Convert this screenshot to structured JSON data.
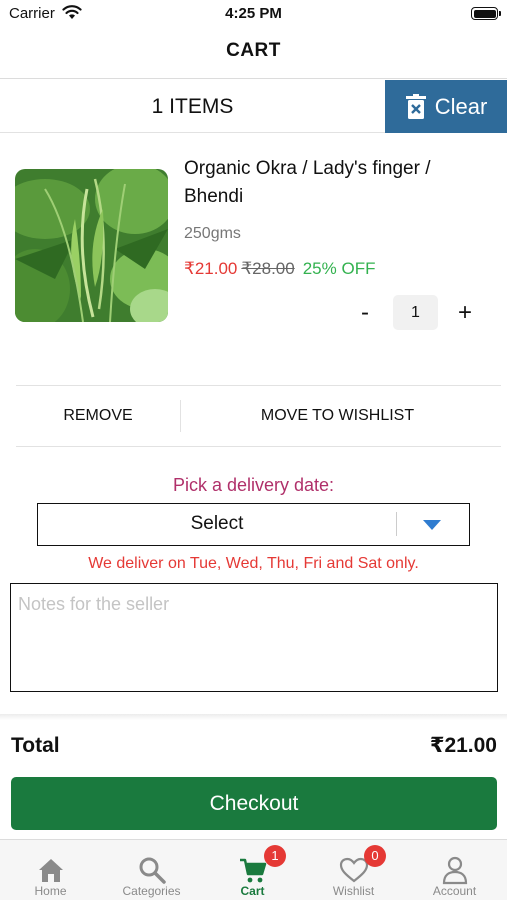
{
  "status_bar": {
    "carrier": "Carrier",
    "time": "4:25 PM"
  },
  "nav": {
    "title": "CART"
  },
  "cart_header": {
    "items_label": "1 ITEMS",
    "clear_label": "Clear",
    "clear_color": "#2f6b9a"
  },
  "product": {
    "name": "Organic Okra / Lady's finger /  Bhendi",
    "weight": "250gms",
    "price": "₹21.00",
    "original_price": "₹28.00",
    "discount": "25% OFF",
    "quantity": "1",
    "minus_label": "-",
    "plus_label": "+"
  },
  "actions": {
    "remove_label": "REMOVE",
    "wishlist_label": "MOVE TO WISHLIST"
  },
  "delivery": {
    "label": "Pick a delivery date:",
    "select_value": "Select",
    "note": "We deliver on Tue, Wed, Thu, Fri and Sat only."
  },
  "notes": {
    "placeholder": "Notes for the seller",
    "value": ""
  },
  "summary": {
    "total_label": "Total",
    "total_value": "₹21.00",
    "checkout_label": "Checkout",
    "checkout_color": "#1a7a3e"
  },
  "tabs": [
    {
      "label": "Home",
      "icon": "home-icon",
      "active": false
    },
    {
      "label": "Categories",
      "icon": "search-icon",
      "active": false
    },
    {
      "label": "Cart",
      "icon": "cart-icon",
      "active": true,
      "badge": "1"
    },
    {
      "label": "Wishlist",
      "icon": "heart-icon",
      "active": false,
      "badge": "0"
    },
    {
      "label": "Account",
      "icon": "user-icon",
      "active": false
    }
  ]
}
